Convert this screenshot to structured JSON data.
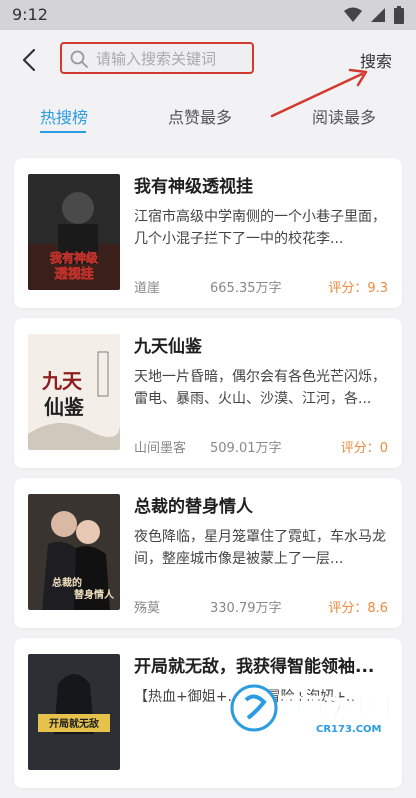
{
  "status": {
    "time": "9:12"
  },
  "search": {
    "placeholder": "请输入搜索关键词",
    "value": "",
    "button_label": "搜索"
  },
  "tabs": [
    {
      "label": "热搜榜",
      "active": true
    },
    {
      "label": "点赞最多",
      "active": false
    },
    {
      "label": "阅读最多",
      "active": false
    }
  ],
  "books": [
    {
      "title": "我有神级透视挂",
      "description": "江宿市高级中学南侧的一个小巷子里面，几个小混子拦下了一中的校花李...",
      "author": "道崖",
      "words": "665.35万字",
      "score": "评分：9.3",
      "cover_text": "我有神级透视挂"
    },
    {
      "title": "九天仙鉴",
      "description": "天地一片昏暗，偶尔会有各色光芒闪烁，雷电、暴雨、火山、沙漠、江河，各...",
      "author": "山间墨客",
      "words": "509.01万字",
      "score": "评分：0",
      "cover_text": "九天仙鉴"
    },
    {
      "title": "总裁的替身情人",
      "description": "夜色降临，星月笼罩住了霓虹，车水马龙间，整座城市像是被蒙上了一层...",
      "author": "殇莫",
      "words": "330.79万字",
      "score": "评分：8.6",
      "cover_text": "总裁的替身情人"
    },
    {
      "title": "开局就无敌，我获得智能领袖...",
      "description": "【热血+御姐+...】+冒险+泡妞+...",
      "author": "",
      "words": "",
      "score": "",
      "cover_text": "开局就无敌"
    }
  ],
  "watermark": {
    "text": "西西软件园",
    "subtext": "CR173.COM"
  },
  "colors": {
    "accent": "#2a9ce2",
    "score": "#f08a3c",
    "highlight": "#d23a2f"
  }
}
